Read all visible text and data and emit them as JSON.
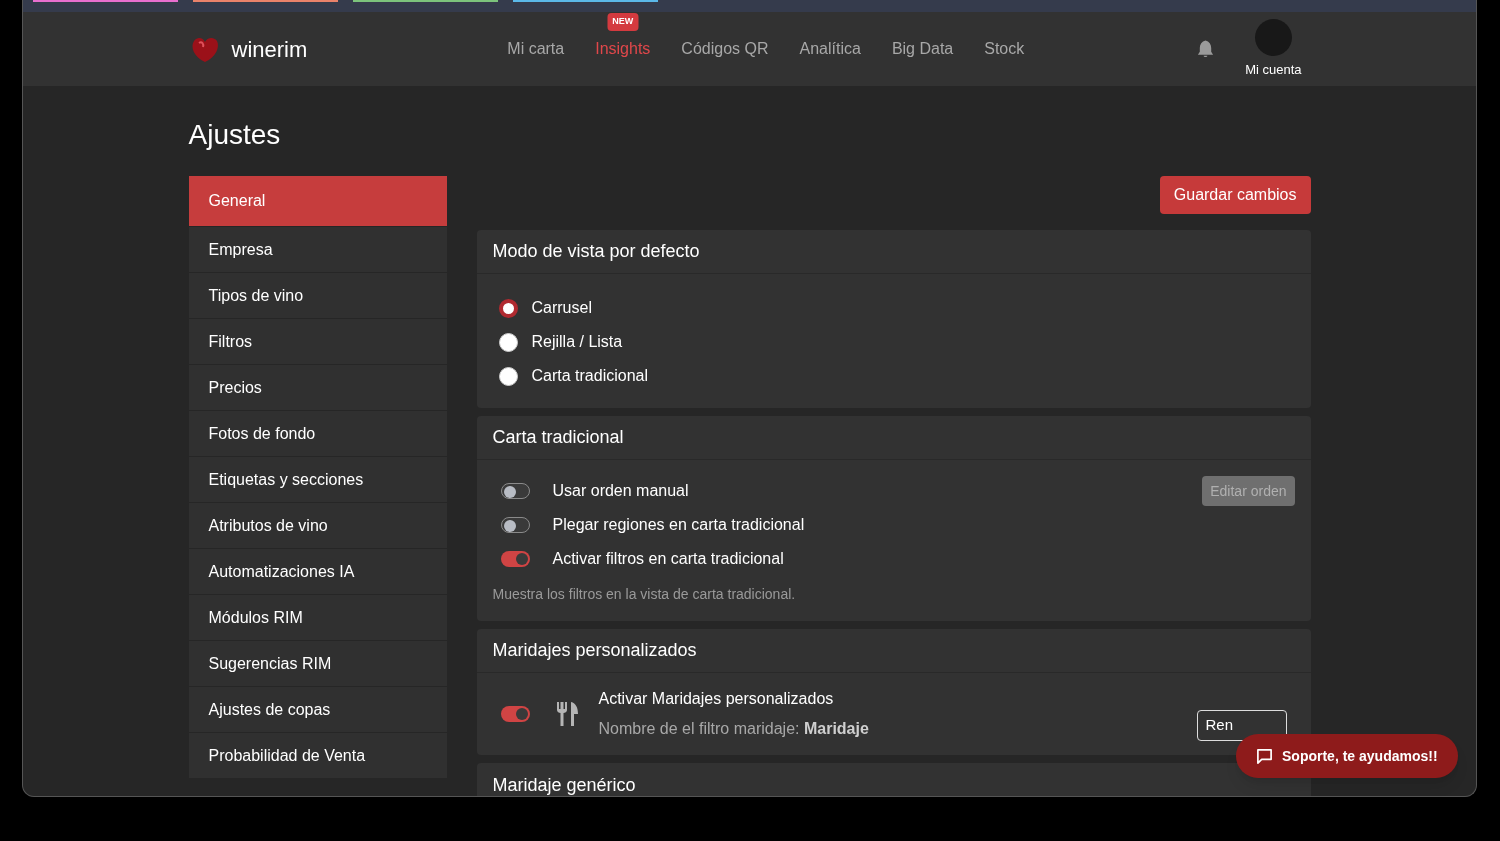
{
  "header": {
    "logo": "winerim",
    "nav": [
      {
        "label": "Mi carta",
        "selected": false
      },
      {
        "label": "Insights",
        "selected": true,
        "badge": "NEW"
      },
      {
        "label": "Códigos QR",
        "selected": false
      },
      {
        "label": "Analítica",
        "selected": false
      },
      {
        "label": "Big Data",
        "selected": false
      },
      {
        "label": "Stock",
        "selected": false
      }
    ],
    "account": "Mi cuenta"
  },
  "page_title": "Ajustes",
  "sidebar": [
    {
      "label": "General",
      "selected": true
    },
    {
      "label": "Empresa",
      "selected": false
    },
    {
      "label": "Tipos de vino",
      "selected": false
    },
    {
      "label": "Filtros",
      "selected": false
    },
    {
      "label": "Precios",
      "selected": false
    },
    {
      "label": "Fotos de fondo",
      "selected": false
    },
    {
      "label": "Etiquetas y secciones",
      "selected": false
    },
    {
      "label": "Atributos de vino",
      "selected": false
    },
    {
      "label": "Automatizaciones IA",
      "selected": false
    },
    {
      "label": "Módulos RIM",
      "selected": false
    },
    {
      "label": "Sugerencias RIM",
      "selected": false
    },
    {
      "label": "Ajustes de copas",
      "selected": false
    },
    {
      "label": "Probabilidad de Venta",
      "selected": false
    }
  ],
  "save_button": "Guardar cambios",
  "sections": [
    {
      "kind": "radio",
      "title": "Modo de vista por defecto",
      "options": [
        {
          "label": "Carrusel",
          "selected": true
        },
        {
          "label": "Rejilla / Lista",
          "selected": false
        },
        {
          "label": "Carta tradicional",
          "selected": false
        }
      ]
    },
    {
      "kind": "toggles",
      "title": "Carta tradicional",
      "toggles": [
        {
          "label": "Usar orden manual",
          "on": false,
          "button": {
            "label": "Editar orden",
            "disabled": true
          }
        },
        {
          "label": "Plegar regiones en carta tradicional",
          "on": false
        },
        {
          "label": "Activar filtros en carta tradicional",
          "on": true
        }
      ],
      "note": "Muestra los filtros en la vista de carta tradicional."
    },
    {
      "kind": "pairing",
      "title": "Maridajes personalizados",
      "on": true,
      "label": "Activar Maridajes personalizados",
      "detail": "Nombre de el filtro maridaje: **Maridaje**",
      "button": "Ren"
    },
    {
      "kind": "header",
      "title": "Maridaje genérico"
    }
  ],
  "support_button": "Soporte, te ayudamos!!"
}
